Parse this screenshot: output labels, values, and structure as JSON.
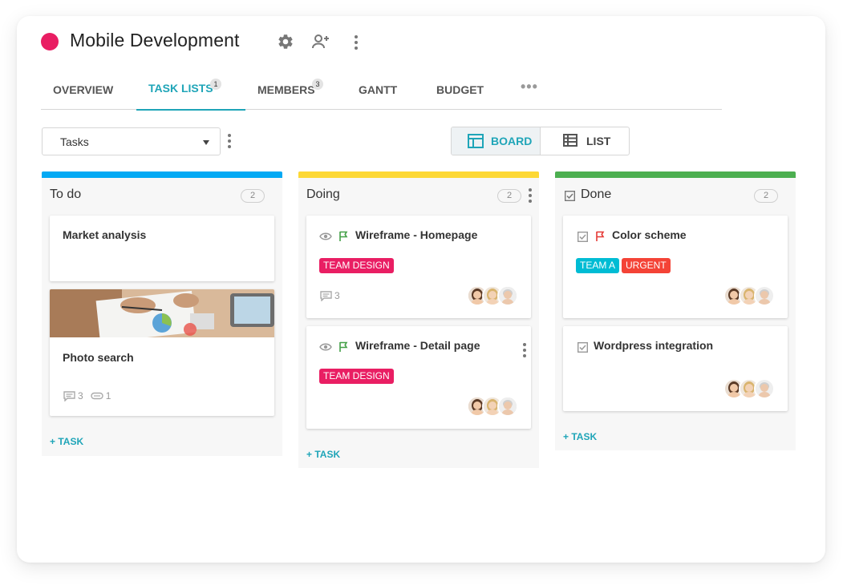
{
  "project": {
    "title": "Mobile Development",
    "color": "#e91e63"
  },
  "tabs": [
    {
      "label": "OVERVIEW",
      "badge": null,
      "active": false
    },
    {
      "label": "TASK LISTS",
      "badge": "1",
      "active": true
    },
    {
      "label": "MEMBERS",
      "badge": "3",
      "active": false
    },
    {
      "label": "GANTT",
      "badge": null,
      "active": false
    },
    {
      "label": "BUDGET",
      "badge": null,
      "active": false
    }
  ],
  "toolbar": {
    "select_value": "Tasks",
    "board_label": "BOARD",
    "list_label": "LIST"
  },
  "columns": [
    {
      "name": "To do",
      "count": "2",
      "color": "#03a9f4",
      "add_label": "+ TASK",
      "cards": [
        {
          "title": "Market analysis"
        },
        {
          "title": "Photo search",
          "comments": "3",
          "attachments": "1"
        }
      ]
    },
    {
      "name": "Doing",
      "count": "2",
      "color": "#fdd835",
      "add_label": "+ TASK",
      "cards": [
        {
          "title": "Wireframe - Homepage",
          "tags": [
            "TEAM DESIGN"
          ],
          "comments": "3"
        },
        {
          "title": "Wireframe - Detail page",
          "tags": [
            "TEAM DESIGN"
          ]
        }
      ]
    },
    {
      "name": "Done",
      "count": "2",
      "color": "#4caf50",
      "add_label": "+ TASK",
      "cards": [
        {
          "title": "Color scheme",
          "tags": [
            "TEAM A",
            "URGENT"
          ]
        },
        {
          "title": "Wordpress integration"
        }
      ]
    }
  ],
  "colors": {
    "accent": "#1fa5b8",
    "tag_design": "#e91e63",
    "tag_team_a": "#00bcd4",
    "tag_urgent": "#f44336",
    "flag_green": "#43a047",
    "flag_red": "#e53935"
  }
}
